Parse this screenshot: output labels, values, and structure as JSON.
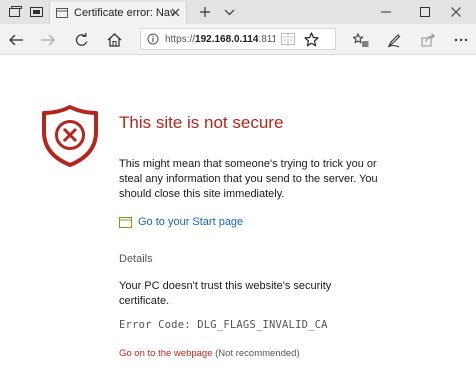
{
  "colors": {
    "shield_red": "#b3261e",
    "link_blue": "#1467c2",
    "danger_link": "#c42b1c",
    "chrome_bg": "#e3e3e3",
    "toolbar_bg": "#f2f2f2"
  },
  "titlebar": {
    "icons": [
      "tab-set-aside-icon",
      "tab-preview-icon"
    ],
    "tab": {
      "icon": "page-icon",
      "title": "Certificate error: Naviga",
      "close_icon": "close-icon"
    },
    "new_tab_icon": "plus-icon",
    "tab_list_icon": "chevron-down-icon",
    "window_buttons": [
      "minimize-icon",
      "maximize-icon",
      "close-icon"
    ]
  },
  "navbar": {
    "back_icon": "back-arrow-icon",
    "forward_icon": "forward-arrow-icon",
    "refresh_icon": "refresh-icon",
    "home_icon": "home-icon",
    "address": {
      "security_icon": "info-icon",
      "url_prefix": "https://",
      "url_host": "192.168.0.114",
      "url_rest": ":8117..."
    },
    "right_icons": [
      "favorites-hub-icon",
      "pen-icon",
      "share-icon",
      "more-icon"
    ]
  },
  "content": {
    "shield_icon": "shield-x-icon",
    "title": "This site is not secure",
    "description": "This might mean that someone's trying to trick you or steal any information that you send to the server. You should close this site immediately.",
    "start_link_icon": "window-icon",
    "start_link": "Go to your Start page",
    "details_heading": "Details",
    "details_text": "Your PC doesn't trust this website's security certificate.",
    "error_code": "Error Code:  DLG_FLAGS_INVALID_CA",
    "go_on_link": "Go on to the webpage",
    "go_on_note": "(Not recommended)"
  }
}
